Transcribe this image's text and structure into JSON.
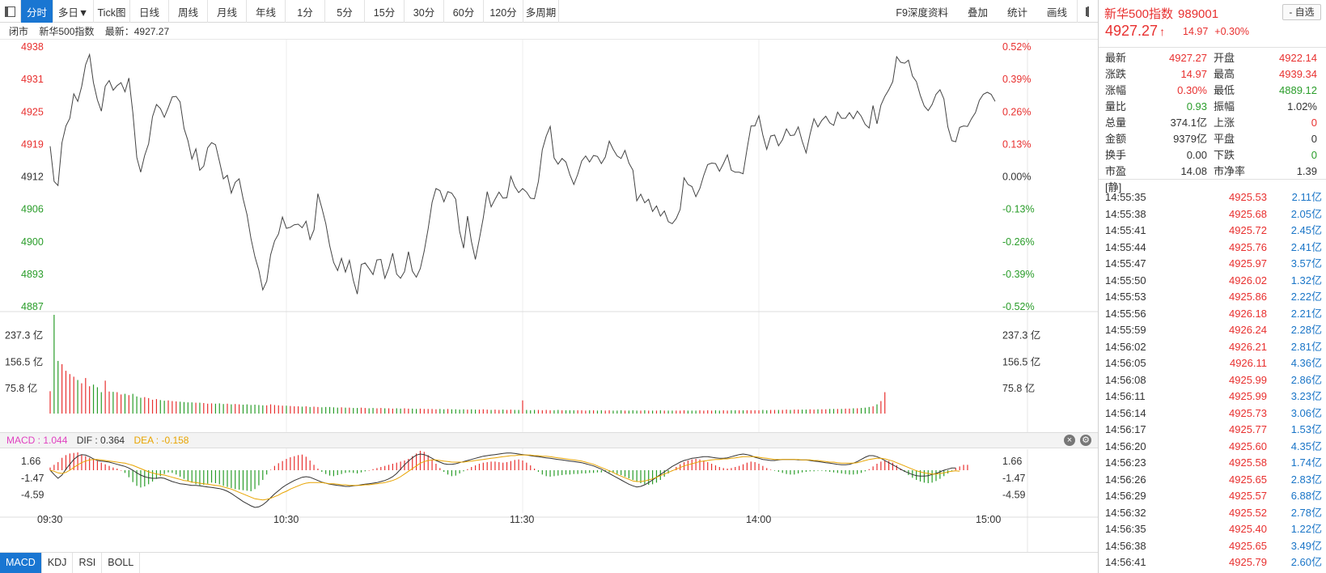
{
  "toolbar": {
    "tabs": [
      "分时",
      "多日▼",
      "Tick图",
      "日线",
      "周线",
      "月线",
      "年线",
      "1分",
      "5分",
      "15分",
      "30分",
      "60分",
      "120分",
      "多周期"
    ],
    "right_items": [
      "F9深度资料",
      "叠加",
      "统计",
      "画线"
    ]
  },
  "status": {
    "state": "闭市",
    "name": "新华500指数",
    "latest": "最新：4927.27"
  },
  "price_axis": {
    "left_labels": [
      "4938",
      "4931",
      "4925",
      "4919",
      "4912",
      "4906",
      "4900",
      "4893",
      "4887"
    ],
    "right_labels": [
      "0.52%",
      "0.39%",
      "0.26%",
      "0.13%",
      "0.00%",
      "-0.13%",
      "-0.26%",
      "-0.39%",
      "-0.52%"
    ],
    "up_color": "#e8302f",
    "down_color": "#2a9d2a",
    "base_color": "#333333"
  },
  "volume_axis": {
    "labels": [
      "237.3 亿",
      "156.5 亿",
      "75.8 亿"
    ]
  },
  "macd": {
    "header": {
      "macd": "MACD : 1.044",
      "dif": "DIF : 0.364",
      "dea": "DEA : -0.158"
    },
    "axis_labels": [
      "1.66",
      "-1.47",
      "-4.59"
    ],
    "dif_color": "#333333",
    "dea_color": "#e8a400"
  },
  "time_axis": [
    "09:30",
    "10:30",
    "11:30",
    "14:00",
    "15:00"
  ],
  "indicator_tabs": [
    "MACD",
    "KDJ",
    "RSI",
    "BOLL"
  ],
  "chart_data": {
    "type": "line",
    "title": "",
    "series": [
      {
        "name": "",
        "unit": "price",
        "values": [
          4918.5,
          4911.6,
          4910.8,
          4919.2,
          4922.5,
          4924.0,
          4928.8,
          4927.3,
          4930.2,
          4934.5,
          4936.5,
          4931.0,
          4927.6,
          4925.4,
          4930.3,
          4931.4,
          4929.5,
          4930.4,
          4931.0,
          4929.2,
          4931.9,
          4925.1,
          4916.3,
          4913.4,
          4916.7,
          4919.0,
          4924.3,
          4926.7,
          4925.9,
          4924.2,
          4926.1,
          4928.2,
          4928.3,
          4927.2,
          4922.0,
          4919.6,
          4916.0,
          4918.0,
          4913.8,
          4914.6,
          4918.2,
          4919.2,
          4918.8,
          4915.5,
          4912.1,
          4912.8,
          4909.3,
          4911.4,
          4912.1,
          4908.2,
          4905.1,
          4900.4,
          4896.8,
          4894.2,
          4890.3,
          4892.0,
          4897.2,
          4899.9,
          4901.3,
          4904.6,
          4902.4,
          4902.6,
          4903.1,
          4903.2,
          4902.5,
          4903.8,
          4900.2,
          4902.1,
          4909.2,
          4906.4,
          4903.3,
          4899.0,
          4895.7,
          4894.1,
          4896.5,
          4893.8,
          4896.1,
          4892.2,
          4889.5,
          4895.3,
          4895.6,
          4894.5,
          4893.3,
          4896.2,
          4896.3,
          4892.6,
          4894.6,
          4897.5,
          4893.4,
          4892.6,
          4893.9,
          4897.8,
          4894.0,
          4892.8,
          4894.5,
          4897.9,
          4902.3,
          4907.5,
          4910.2,
          4909.8,
          4907.6,
          4909.6,
          4909.3,
          4908.1,
          4901.8,
          4898.5,
          4904.8,
          4899.8,
          4896.3,
          4900.3,
          4904.4,
          4909.6,
          4906.6,
          4908.1,
          4909.5,
          4908.3,
          4908.4,
          4912.6,
          4910.6,
          4909.4,
          4910.2,
          4909.5,
          4908.3,
          4908.2,
          4911.6,
          4917.8,
          4920.5,
          4922.4,
          4916.2,
          4915.0,
          4916.1,
          4915.4,
          4912.9,
          4911.0,
          4913.0,
          4915.6,
          4916.6,
          4915.4,
          4916.7,
          4916.5,
          4915.1,
          4916.4,
          4919.5,
          4917.9,
          4916.6,
          4916.1,
          4917.7,
          4915.2,
          4913.8,
          4907.8,
          4909.1,
          4907.4,
          4908.1,
          4905.7,
          4906.8,
          4904.8,
          4905.8,
          4903.7,
          4903.3,
          4904.3,
          4906.1,
          4912.3,
          4911.0,
          4910.6,
          4908.6,
          4910.2,
          4912.8,
          4914.9,
          4915.2,
          4915.1,
          4913.6,
          4915.1,
          4916.8,
          4913.8,
          4913.4,
          4913.4,
          4913.1,
          4918.0,
          4922.5,
          4922.5,
          4924.5,
          4920.7,
          4917.9,
          4920.5,
          4920.7,
          4918.6,
          4919.8,
          4921.9,
          4920.6,
          4920.7,
          4922.3,
          4919.5,
          4917.2,
          4920.9,
          4923.9,
          4922.3,
          4923.6,
          4924.4,
          4923.1,
          4922.6,
          4925.2,
          4924.0,
          4924.0,
          4925.1,
          4923.9,
          4925.4,
          4924.4,
          4922.8,
          4922.1,
          4926.5,
          4922.9,
          4926.6,
          4928.3,
          4929.6,
          4931.2,
          4936.1,
          4935.0,
          4934.8,
          4935.4,
          4932.3,
          4931.2,
          4928.5,
          4926.4,
          4925.5,
          4926.7,
          4928.7,
          4929.6,
          4927.8,
          4922.3,
          4919.6,
          4919.4,
          4922.2,
          4922.5,
          4922.4,
          4923.9,
          4925.1,
          4927.5,
          4928.7,
          4929.1,
          4928.7,
          4927.3
        ]
      }
    ],
    "volume": [
      68,
      300,
      160,
      150,
      130,
      120,
      112,
      102,
      92,
      108,
      83,
      88,
      80,
      65,
      100,
      67,
      66,
      65,
      58,
      60,
      56,
      60,
      52,
      48,
      50,
      47,
      42,
      44,
      41,
      39,
      40,
      38,
      37,
      36,
      35,
      34,
      34,
      33,
      33,
      32,
      30,
      31,
      30,
      31,
      29,
      30,
      28,
      29,
      28,
      27,
      28,
      26,
      27,
      26,
      25,
      25,
      28,
      26,
      25,
      24,
      24,
      23,
      22,
      22,
      21,
      22,
      20,
      21,
      20,
      19,
      20,
      20,
      19,
      18,
      19,
      18,
      18,
      17,
      17,
      18,
      17,
      16,
      17,
      16,
      17,
      16,
      16,
      15,
      16,
      15,
      16,
      15,
      15,
      14,
      15,
      14,
      14,
      14,
      13,
      14,
      13,
      14,
      13,
      13,
      12,
      13,
      12,
      13,
      12,
      12,
      13,
      12,
      11,
      12,
      11,
      12,
      11,
      12,
      11,
      11,
      40,
      11,
      10,
      11,
      11,
      10,
      11,
      10,
      10,
      11,
      10,
      10,
      10,
      10,
      10,
      10,
      9,
      10,
      10,
      9,
      10,
      9,
      10,
      9,
      9,
      10,
      9,
      9,
      10,
      9,
      9,
      10,
      9,
      9,
      9,
      10,
      9,
      9,
      9,
      9,
      9,
      10,
      9,
      9,
      9,
      10,
      9,
      10,
      9,
      10,
      9,
      10,
      9,
      10,
      10,
      10,
      10,
      10,
      10,
      10,
      10,
      11,
      10,
      11,
      11,
      11,
      11,
      12,
      11,
      12,
      12,
      12,
      12,
      13,
      12,
      13,
      13,
      13,
      14,
      14,
      14,
      14,
      15,
      15,
      16,
      16,
      17,
      18,
      20,
      22,
      28,
      38,
      65
    ],
    "macd_hist": [
      0.5,
      1.0,
      1.5,
      2.3,
      2.8,
      3.1,
      3.2,
      3.3,
      2.9,
      2.6,
      2.3,
      2.0,
      1.7,
      1.4,
      1.1,
      0.8,
      0.5,
      0.3,
      0.0,
      -0.5,
      -1.3,
      -2.2,
      -2.9,
      -3.2,
      -3.0,
      -2.6,
      -2.1,
      -1.6,
      -1.1,
      -0.7,
      -0.4,
      -0.5,
      -0.8,
      -1.2,
      -1.6,
      -2.0,
      -2.3,
      -2.6,
      -2.8,
      -2.7,
      -2.5,
      -2.3,
      -2.4,
      -2.6,
      -2.9,
      -3.1,
      -3.3,
      -3.5,
      -3.6,
      -3.7,
      -3.8,
      -3.9,
      -3.5,
      -2.8,
      -1.8,
      -0.8,
      0.1,
      0.8,
      1.3,
      1.7,
      2.1,
      2.4,
      2.6,
      2.8,
      2.9,
      2.5,
      1.8,
      1.0,
      0.3,
      -0.3,
      -0.7,
      -1.0,
      -1.1,
      -0.9,
      -0.7,
      -0.5,
      -0.4,
      -0.5,
      -0.6,
      -0.4,
      -0.2,
      0.0,
      0.2,
      0.4,
      0.6,
      0.8,
      1.0,
      1.2,
      1.4,
      1.6,
      1.8,
      2.1,
      2.6,
      3.1,
      3.6,
      3.4,
      2.8,
      2.0,
      1.2,
      0.4,
      -0.3,
      -0.8,
      -1.1,
      -1.0,
      -0.6,
      -0.2,
      0.2,
      0.6,
      0.9,
      1.2,
      1.4,
      1.5,
      1.6,
      1.6,
      1.5,
      1.4,
      1.5,
      1.7,
      1.9,
      2.0,
      1.8,
      1.4,
      0.9,
      0.3,
      -0.3,
      -0.8,
      -1.1,
      -1.2,
      -1.1,
      -1.0,
      -0.9,
      -0.8,
      -0.8,
      -0.7,
      -0.7,
      -0.6,
      -0.6,
      -0.5,
      -0.5,
      -0.4,
      -0.4,
      -0.3,
      -0.4,
      -0.5,
      -0.7,
      -0.9,
      -1.2,
      -1.5,
      -1.8,
      -2.1,
      -2.4,
      -2.6,
      -2.7,
      -2.6,
      -2.3,
      -1.8,
      -1.2,
      -0.6,
      0.0,
      0.6,
      1.1,
      1.5,
      1.8,
      2.0,
      2.1,
      2.0,
      1.8,
      1.5,
      1.2,
      0.9,
      0.6,
      0.4,
      0.3,
      0.4,
      0.6,
      0.8,
      1.1,
      1.4,
      1.6,
      1.5,
      1.2,
      0.8,
      0.4,
      0.1,
      -0.1,
      -0.3,
      -0.5,
      -0.7,
      -0.8,
      -0.8,
      -0.6,
      -0.4,
      -0.3,
      -0.2,
      -0.2,
      -0.1,
      -0.1,
      -0.2,
      -0.3,
      -0.4,
      -0.5,
      -0.6,
      -0.7,
      -0.8,
      -0.8,
      -0.7,
      -0.5,
      -0.2,
      0.2,
      0.7,
      1.2,
      1.6,
      1.8,
      1.7,
      1.4,
      0.9,
      0.3,
      -0.3,
      -0.9,
      -1.4,
      -1.8,
      -2.1,
      -2.3,
      -2.4,
      -2.3,
      -2.0,
      -1.6,
      -1.1,
      -0.6,
      -0.1,
      0.4,
      0.7,
      1.0,
      1.0
    ],
    "dif": [
      0.0,
      -0.8,
      -1.5,
      -0.9,
      0.2,
      1.1,
      2.0,
      2.6,
      2.9,
      2.8,
      2.5,
      2.1,
      1.8,
      1.7,
      1.6,
      1.5,
      1.3,
      1.1,
      0.9,
      0.7,
      0.4,
      0.0,
      -0.5,
      -0.9,
      -1.2,
      -1.4,
      -1.5,
      -1.5,
      -1.4,
      -1.5,
      -1.8,
      -2.1,
      -2.3,
      -2.5,
      -2.6,
      -2.7,
      -2.8,
      -2.8,
      -2.9,
      -3.0,
      -3.1,
      -3.2,
      -3.3,
      -3.4,
      -3.6,
      -3.9,
      -4.3,
      -4.8,
      -5.3,
      -5.8,
      -6.2,
      -6.6,
      -6.9,
      -6.8,
      -6.4,
      -5.8,
      -5.1,
      -4.4,
      -3.8,
      -3.2,
      -2.7,
      -2.3,
      -1.9,
      -1.6,
      -1.3,
      -1.2,
      -1.3,
      -1.6,
      -1.9,
      -2.2,
      -2.4,
      -2.6,
      -2.7,
      -2.8,
      -2.9,
      -3.0,
      -3.0,
      -2.9,
      -2.8,
      -2.7,
      -2.6,
      -2.5,
      -2.4,
      -2.3,
      -2.1,
      -1.9,
      -1.6,
      -1.2,
      -0.6,
      0.2,
      1.0,
      1.7,
      2.3,
      2.8,
      3.0,
      2.9,
      2.6,
      2.2,
      1.8,
      1.5,
      1.2,
      1.1,
      1.1,
      1.2,
      1.4,
      1.6,
      1.8,
      2.0,
      2.2,
      2.4,
      2.6,
      2.7,
      2.8,
      2.9,
      3.0,
      3.1,
      3.2,
      3.2,
      3.1,
      3.0,
      2.9,
      2.8,
      2.7,
      2.6,
      2.5,
      2.4,
      2.3,
      2.2,
      2.1,
      2.0,
      1.9,
      1.8,
      1.7,
      1.6,
      1.5,
      1.4,
      1.2,
      1.0,
      0.8,
      0.5,
      0.2,
      -0.2,
      -0.6,
      -1.0,
      -1.4,
      -1.8,
      -2.2,
      -2.6,
      -2.9,
      -3.1,
      -3.0,
      -2.7,
      -2.3,
      -1.8,
      -1.3,
      -0.8,
      -0.3,
      0.2,
      0.7,
      1.1,
      1.5,
      1.8,
      2.0,
      2.2,
      2.3,
      2.4,
      2.5,
      2.5,
      2.4,
      2.3,
      2.2,
      2.2,
      2.3,
      2.5,
      2.7,
      2.9,
      3.0,
      2.9,
      2.7,
      2.4,
      2.2,
      2.0,
      1.9,
      1.8,
      1.8,
      1.9,
      2.0,
      2.0,
      2.0,
      2.0,
      1.9,
      1.9,
      1.9,
      1.8,
      1.7,
      1.6,
      1.5,
      1.4,
      1.3,
      1.2,
      1.1,
      1.0,
      1.0,
      1.1,
      1.3,
      1.6,
      2.0,
      2.4,
      2.7,
      2.7,
      2.5,
      2.2,
      1.8,
      1.4,
      1.0,
      0.6,
      0.2,
      -0.2,
      -0.5,
      -0.8,
      -1.0,
      -1.1,
      -1.1,
      -1.0,
      -0.8,
      -0.6,
      -0.3,
      0.0,
      0.2,
      0.4,
      0.4
    ],
    "dea": [
      0.0,
      -0.2,
      -0.5,
      -0.6,
      -0.4,
      0.0,
      0.5,
      1.0,
      1.4,
      1.7,
      1.9,
      2.0,
      2.0,
      1.9,
      1.8,
      1.7,
      1.6,
      1.5,
      1.4,
      1.3,
      1.1,
      0.9,
      0.6,
      0.3,
      0.0,
      -0.3,
      -0.5,
      -0.7,
      -0.8,
      -0.9,
      -1.1,
      -1.3,
      -1.5,
      -1.7,
      -1.9,
      -2.0,
      -2.2,
      -2.3,
      -2.4,
      -2.5,
      -2.6,
      -2.7,
      -2.8,
      -2.9,
      -3.1,
      -3.3,
      -3.5,
      -3.8,
      -4.1,
      -4.4,
      -4.7,
      -5.0,
      -5.3,
      -5.4,
      -5.5,
      -5.4,
      -5.2,
      -4.9,
      -4.6,
      -4.2,
      -3.9,
      -3.5,
      -3.2,
      -2.9,
      -2.6,
      -2.4,
      -2.3,
      -2.3,
      -2.3,
      -2.3,
      -2.4,
      -2.5,
      -2.5,
      -2.6,
      -2.7,
      -2.7,
      -2.8,
      -2.8,
      -2.8,
      -2.8,
      -2.7,
      -2.7,
      -2.6,
      -2.5,
      -2.4,
      -2.3,
      -2.1,
      -1.9,
      -1.6,
      -1.2,
      -0.7,
      -0.2,
      0.3,
      0.8,
      1.3,
      1.6,
      1.8,
      1.9,
      1.9,
      1.8,
      1.7,
      1.6,
      1.5,
      1.5,
      1.5,
      1.5,
      1.6,
      1.7,
      1.8,
      1.9,
      2.0,
      2.1,
      2.2,
      2.3,
      2.4,
      2.5,
      2.6,
      2.7,
      2.7,
      2.8,
      2.8,
      2.8,
      2.8,
      2.7,
      2.7,
      2.6,
      2.6,
      2.5,
      2.4,
      2.3,
      2.2,
      2.1,
      2.0,
      1.9,
      1.8,
      1.7,
      1.5,
      1.3,
      1.1,
      0.8,
      0.5,
      0.2,
      -0.1,
      -0.4,
      -0.8,
      -1.1,
      -1.4,
      -1.7,
      -2.0,
      -2.1,
      -2.1,
      -2.0,
      -1.8,
      -1.6,
      -1.3,
      -1.0,
      -0.7,
      -0.4,
      -0.1,
      0.2,
      0.5,
      0.8,
      1.0,
      1.2,
      1.4,
      1.6,
      1.7,
      1.8,
      1.9,
      2.0,
      2.0,
      2.1,
      2.1,
      2.2,
      2.3,
      2.4,
      2.5,
      2.5,
      2.5,
      2.5,
      2.4,
      2.3,
      2.2,
      2.1,
      2.0,
      2.0,
      2.0,
      2.0,
      2.0,
      2.0,
      2.0,
      1.9,
      1.9,
      1.9,
      1.8,
      1.8,
      1.7,
      1.6,
      1.5,
      1.5,
      1.4,
      1.3,
      1.3,
      1.3,
      1.3,
      1.4,
      1.6,
      1.8,
      2.0,
      2.1,
      2.2,
      2.2,
      2.1,
      1.9,
      1.7,
      1.4,
      1.1,
      0.8,
      0.5,
      0.2,
      -0.1,
      -0.3,
      -0.5,
      -0.6,
      -0.7,
      -0.7,
      -0.6,
      -0.5,
      -0.3,
      -0.2,
      -0.1,
      -0.2
    ],
    "price_range": [
      4887,
      4938
    ],
    "base_price": 4912.3,
    "volume_max_yi": 300,
    "macd_range": [
      -7.2,
      3.9
    ]
  },
  "right_panel": {
    "name": "新华500指数",
    "code": "989001",
    "watch_label": "- 自选",
    "price": "4927.27",
    "arrow": "↑",
    "change": "14.97",
    "change_pct": "+0.30%",
    "quote_rows": [
      {
        "l1": "最新",
        "v1": "4927.27",
        "c1": "red",
        "l2": "开盘",
        "v2": "4922.14",
        "c2": "red"
      },
      {
        "l1": "涨跌",
        "v1": "14.97",
        "c1": "red",
        "l2": "最高",
        "v2": "4939.34",
        "c2": "red"
      },
      {
        "l1": "涨幅",
        "v1": "0.30%",
        "c1": "red",
        "l2": "最低",
        "v2": "4889.12",
        "c2": "green"
      },
      {
        "l1": "量比",
        "v1": "0.93",
        "c1": "green",
        "l2": "振幅",
        "v2": "1.02%",
        "c2": "dark"
      },
      {
        "l1": "总量",
        "v1": "374.1亿",
        "c1": "dark",
        "l2": "上涨",
        "v2": "0",
        "c2": "red"
      },
      {
        "l1": "金额",
        "v1": "9379亿",
        "c1": "dark",
        "l2": "平盘",
        "v2": "0",
        "c2": "dark"
      },
      {
        "l1": "换手",
        "v1": "0.00",
        "c1": "dark",
        "l2": "下跌",
        "v2": "0",
        "c2": "green"
      },
      {
        "l1": "市盈[静]",
        "v1": "14.08",
        "c1": "dark",
        "l2": "市净率",
        "v2": "1.39",
        "c2": "dark"
      }
    ],
    "ticks": [
      {
        "t": "14:55:35",
        "p": "4925.53",
        "v": "2.11亿"
      },
      {
        "t": "14:55:38",
        "p": "4925.68",
        "v": "2.05亿"
      },
      {
        "t": "14:55:41",
        "p": "4925.72",
        "v": "2.45亿"
      },
      {
        "t": "14:55:44",
        "p": "4925.76",
        "v": "2.41亿"
      },
      {
        "t": "14:55:47",
        "p": "4925.97",
        "v": "3.57亿"
      },
      {
        "t": "14:55:50",
        "p": "4926.02",
        "v": "1.32亿"
      },
      {
        "t": "14:55:53",
        "p": "4925.86",
        "v": "2.22亿"
      },
      {
        "t": "14:55:56",
        "p": "4926.18",
        "v": "2.21亿"
      },
      {
        "t": "14:55:59",
        "p": "4926.24",
        "v": "2.28亿"
      },
      {
        "t": "14:56:02",
        "p": "4926.21",
        "v": "2.81亿"
      },
      {
        "t": "14:56:05",
        "p": "4926.11",
        "v": "4.36亿"
      },
      {
        "t": "14:56:08",
        "p": "4925.99",
        "v": "2.86亿"
      },
      {
        "t": "14:56:11",
        "p": "4925.99",
        "v": "3.23亿"
      },
      {
        "t": "14:56:14",
        "p": "4925.73",
        "v": "3.06亿"
      },
      {
        "t": "14:56:17",
        "p": "4925.77",
        "v": "1.53亿"
      },
      {
        "t": "14:56:20",
        "p": "4925.60",
        "v": "4.35亿"
      },
      {
        "t": "14:56:23",
        "p": "4925.58",
        "v": "1.74亿"
      },
      {
        "t": "14:56:26",
        "p": "4925.65",
        "v": "2.83亿"
      },
      {
        "t": "14:56:29",
        "p": "4925.57",
        "v": "6.88亿"
      },
      {
        "t": "14:56:32",
        "p": "4925.52",
        "v": "2.78亿"
      },
      {
        "t": "14:56:35",
        "p": "4925.40",
        "v": "1.22亿"
      },
      {
        "t": "14:56:38",
        "p": "4925.65",
        "v": "3.49亿"
      },
      {
        "t": "14:56:41",
        "p": "4925.79",
        "v": "2.60亿"
      }
    ]
  }
}
